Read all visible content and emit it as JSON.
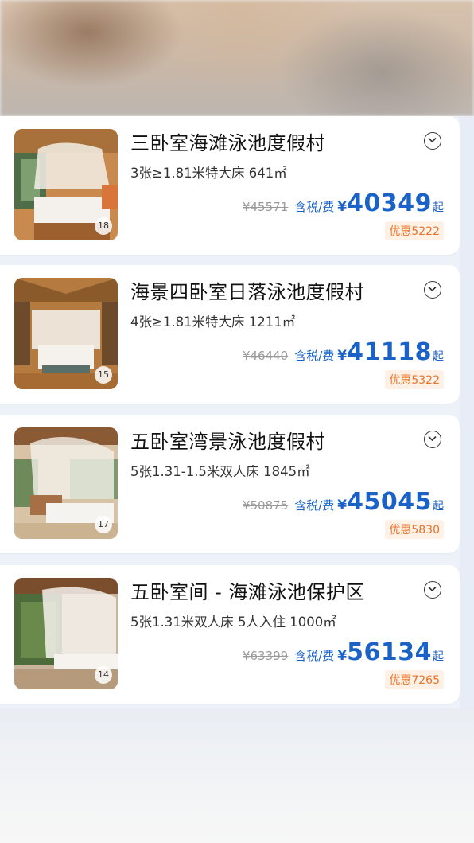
{
  "rooms": [
    {
      "title": "三卧室海滩泳池度假村",
      "spec": "3张≥1.81米特大床  641㎡",
      "original_price": "¥45571",
      "tax_label": "含税/费",
      "currency": "¥",
      "price": "40349",
      "price_suffix": "起",
      "discount": "优惠5222",
      "photo_count": "18"
    },
    {
      "title": "海景四卧室日落泳池度假村",
      "spec": "4张≥1.81米特大床  1211㎡",
      "original_price": "¥46440",
      "tax_label": "含税/费",
      "currency": "¥",
      "price": "41118",
      "price_suffix": "起",
      "discount": "优惠5322",
      "photo_count": "15"
    },
    {
      "title": "五卧室湾景泳池度假村",
      "spec": "5张1.31-1.5米双人床  1845㎡",
      "original_price": "¥50875",
      "tax_label": "含税/费",
      "currency": "¥",
      "price": "45045",
      "price_suffix": "起",
      "discount": "优惠5830",
      "photo_count": "17"
    },
    {
      "title": "五卧室间 - 海滩泳池保护区",
      "spec": "5张1.31米双人床  5人入住  1000㎡",
      "original_price": "¥63399",
      "tax_label": "含税/费",
      "currency": "¥",
      "price": "56134",
      "price_suffix": "起",
      "discount": "优惠7265",
      "photo_count": "14"
    }
  ],
  "icons": {
    "expand": "chevron-down-icon"
  },
  "colors": {
    "price": "#1a62c7",
    "discount": "#e8742a",
    "discount_bg": "#fff1e6"
  }
}
